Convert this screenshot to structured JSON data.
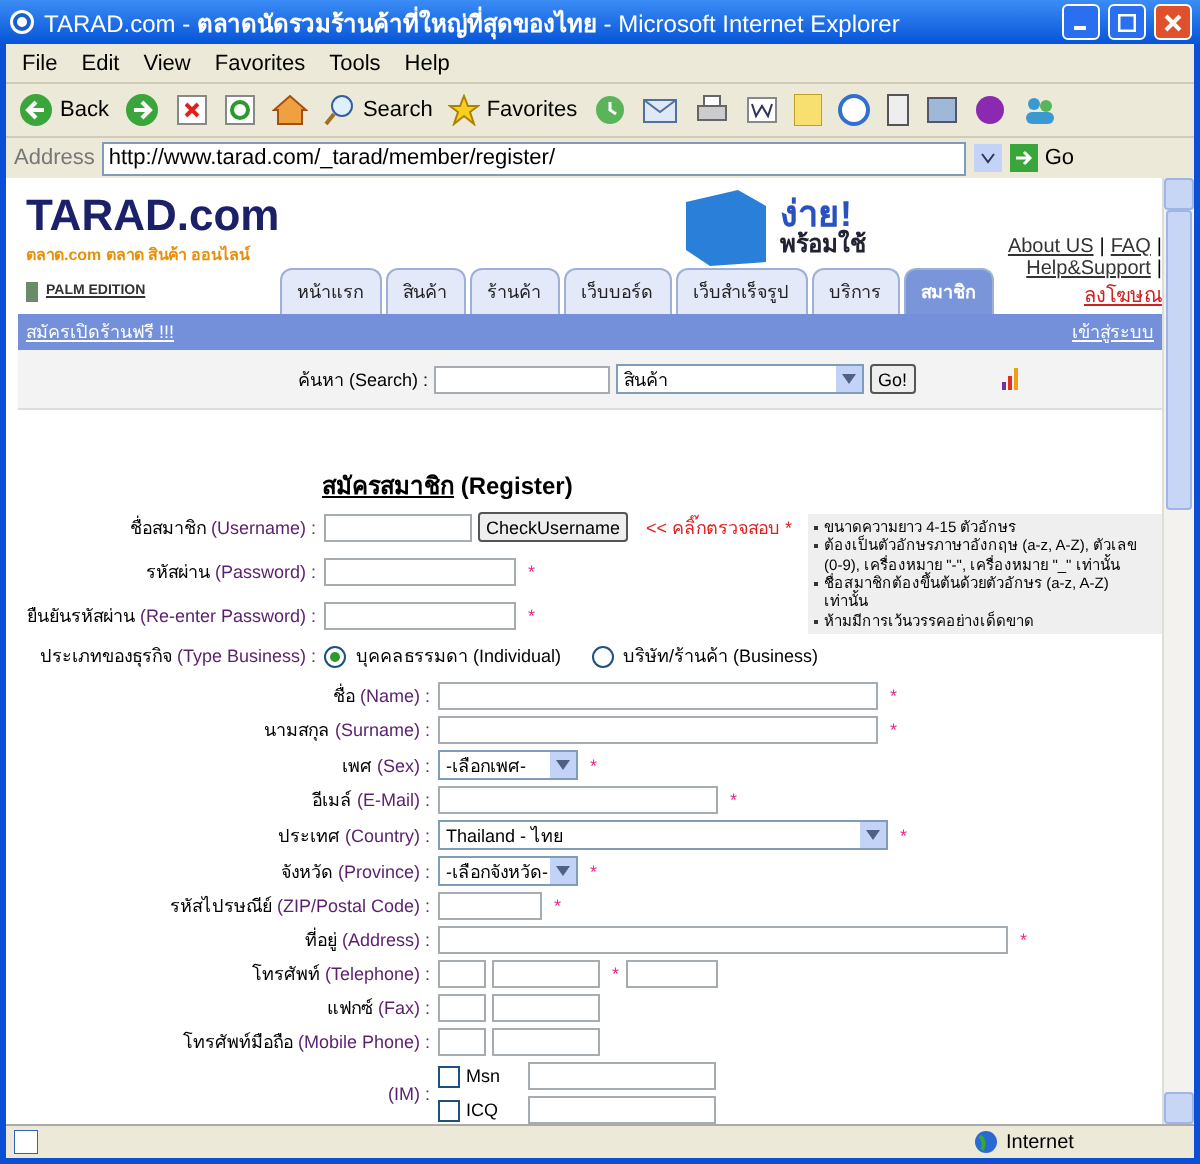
{
  "window": {
    "title_site": "TARAD.com - ",
    "title_page": "ตลาดนัดรวมร้านค้าที่ใหญ่ที่สุดของไทย",
    "title_app": " - Microsoft Internet Explorer"
  },
  "menu": [
    "File",
    "Edit",
    "View",
    "Favorites",
    "Tools",
    "Help"
  ],
  "toolbar": {
    "back": "Back",
    "search": "Search",
    "favorites": "Favorites"
  },
  "address": {
    "label": "Address",
    "url": "http://www.tarad.com/_tarad/member/register/",
    "go": "Go"
  },
  "site": {
    "logo": "TARAD.com",
    "tagline": "ตลาด.com ตลาด สินค้า ออนไลน์",
    "edition": "PALM EDITION",
    "banner_top": "ง่าย!",
    "banner_bottom": "พร้อมใช้",
    "tabs": [
      {
        "label": "หน้าแรก",
        "selected": false
      },
      {
        "label": "สินค้า",
        "selected": false
      },
      {
        "label": "ร้านค้า",
        "selected": false
      },
      {
        "label": "เว็บบอร์ด",
        "selected": false
      },
      {
        "label": "เว็บสำเร็จรูป",
        "selected": false
      },
      {
        "label": "บริการ",
        "selected": false
      },
      {
        "label": "สมาชิก",
        "selected": true
      }
    ],
    "links": [
      "About US",
      "FAQ",
      "Help&Support",
      "ลงโฆษณ"
    ],
    "link_separator": "|",
    "bar_left": "สมัครเปิดร้านฟรี !!!",
    "bar_right": "เข้าสู่ระบบ",
    "search": {
      "label": "ค้นหา (Search) :",
      "category": "สินค้า",
      "button": "Go!"
    }
  },
  "form": {
    "title_th": "สมัครสมาชิก",
    "title_en": " (Register)",
    "username": {
      "label_th": "ชื่อสมาชิก",
      "label_en": "(Username) :",
      "button": "CheckUsername",
      "hint": "<< คลิ๊กตรวจสอบ *"
    },
    "password": {
      "label_th": "รหัสผ่าน",
      "label_en": "(Password) :",
      "required_mark": "*"
    },
    "confirm": {
      "label_th": "ยืนยันรหัสผ่าน",
      "label_en": "(Re-enter Password) :",
      "required_mark": "*"
    },
    "rules": [
      "ขนาดความยาว 4-15 ตัวอักษร",
      "ต้องเป็นตัวอักษรภาษาอังกฤษ (a-z, A-Z), ตัวเลข (0-9), เครื่องหมาย \"-\", เครื่องหมาย \"_\" เท่านั้น",
      "ชื่อสมาชิกต้องขึ้นต้นด้วยตัวอักษร (a-z, A-Z) เท่านั้น",
      "ห้ามมีการเว้นวรรคอย่างเด็ดขาด"
    ],
    "business": {
      "label_th": "ประเภทของธุรกิจ",
      "label_en": "(Type Business) :",
      "options": [
        {
          "label": "บุคคลธรรมดา (Individual)",
          "selected": true
        },
        {
          "label": "บริษัท/ร้านค้า (Business)",
          "selected": false
        }
      ]
    },
    "fields": [
      {
        "kind": "text",
        "label_th": "ชื่อ",
        "label_en": "(Name) :",
        "required_mark": "*"
      },
      {
        "kind": "text",
        "label_th": "นามสกุล",
        "label_en": "(Surname) :",
        "required_mark": "*"
      },
      {
        "kind": "select",
        "label_th": "เพศ",
        "label_en": "(Sex) :",
        "value": "-เลือกเพศ-",
        "required_mark": "*"
      },
      {
        "kind": "text",
        "label_th": "อีเมล์",
        "label_en": "(E-Mail) :",
        "required_mark": "*"
      },
      {
        "kind": "select",
        "label_th": "ประเทศ",
        "label_en": "(Country) :",
        "value": "Thailand - ไทย",
        "required_mark": "*"
      },
      {
        "kind": "select",
        "label_th": "จังหวัด",
        "label_en": "(Province) :",
        "value": "-เลือกจังหวัด-",
        "required_mark": "*"
      },
      {
        "kind": "text",
        "label_th": "รหัสไปรษณีย์",
        "label_en": "(ZIP/Postal Code) :",
        "required_mark": "*"
      },
      {
        "kind": "text",
        "label_th": "ที่อยู่",
        "label_en": "(Address) :",
        "required_mark": "*"
      },
      {
        "kind": "phone",
        "label_th": "โทรศัพท์",
        "label_en": "(Telephone) :",
        "required_mark": "*"
      },
      {
        "kind": "pair",
        "label_th": "แฟกซ์",
        "label_en": "(Fax) :"
      },
      {
        "kind": "pair",
        "label_th": "โทรศัพท์มือถือ",
        "label_en": "(Mobile Phone) :"
      }
    ],
    "im": {
      "label": "(IM) :",
      "options": [
        {
          "label": "Msn",
          "checked": false
        },
        {
          "label": "ICQ",
          "checked": false
        }
      ]
    }
  },
  "status_bar": {
    "zone": "Internet"
  }
}
